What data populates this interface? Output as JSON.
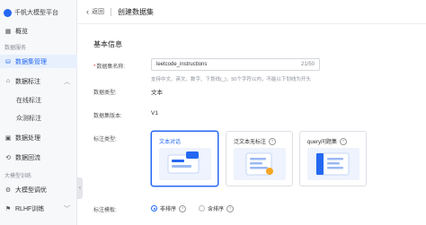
{
  "app": {
    "title": "千帆大模型平台"
  },
  "sidebar": {
    "overview": "概览",
    "group_data_service": "数据服务",
    "dataset_mgmt": "数据集管理",
    "data_annotation": "数据标注",
    "online_annotation": "在线标注",
    "crowd_annotation": "众测标注",
    "data_processing": "数据处理",
    "data_reflow": "数据回流",
    "group_model_training": "大模型训练",
    "model_tuning": "大模型调优",
    "rlhf": "RLHF训练"
  },
  "header": {
    "back": "返回",
    "title": "创建数据集"
  },
  "form": {
    "section_title": "基本信息",
    "name_label": "数据集名称:",
    "name_value": "leetcode_instructions",
    "name_count": "21/50",
    "name_hint": "支持中文、英文、数字、下划线(_)，50个字符以内，不能以下划线为开头",
    "type_label": "数据类型:",
    "type_value": "文本",
    "version_label": "数据集版本:",
    "version_value": "V1",
    "annot_type_label": "标注类型:",
    "cards": [
      {
        "label": "文本对话",
        "selected": true
      },
      {
        "label": "泛文本无标注",
        "selected": false
      },
      {
        "label": "query问题集",
        "selected": false
      }
    ],
    "template_label": "标注模板:",
    "template_options": [
      {
        "label": "非排序",
        "selected": true
      },
      {
        "label": "含排序",
        "selected": false
      }
    ]
  },
  "colors": {
    "accent": "#2468f2",
    "sidebar_bg": "#f7f8fa",
    "active_bg": "#e8f0fe"
  }
}
